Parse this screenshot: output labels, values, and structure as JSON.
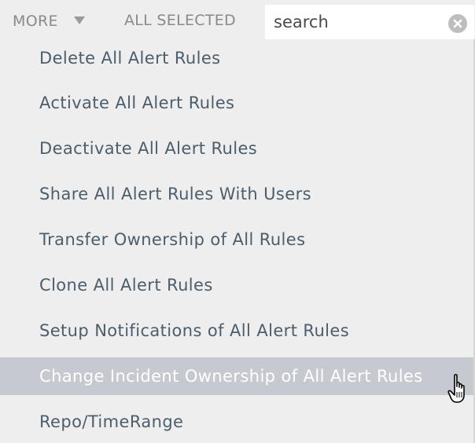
{
  "toolbar": {
    "more_label": "MORE",
    "all_selected_label": "ALL SELECTED",
    "search": {
      "value": "",
      "placeholder": "search"
    }
  },
  "menu": {
    "items": [
      {
        "label": "Delete All Alert Rules"
      },
      {
        "label": "Activate All Alert Rules"
      },
      {
        "label": "Deactivate All Alert Rules"
      },
      {
        "label": "Share All Alert Rules With Users"
      },
      {
        "label": "Transfer Ownership of All Rules"
      },
      {
        "label": "Clone All Alert Rules"
      },
      {
        "label": "Setup Notifications of All Alert Rules"
      },
      {
        "label": "Change Incident Ownership of All Alert Rules",
        "highlighted": true
      },
      {
        "label": "Repo/TimeRange"
      }
    ]
  },
  "icons": {
    "more_dropdown": "caret-down-icon",
    "clear_search": "close-circle-icon",
    "cursor": "hand-pointer-icon"
  },
  "colors": {
    "toolbar_text": "#8a8a8a",
    "menu_text": "#4c5d6c",
    "highlight_bg": "#c7c9d0",
    "highlight_text": "#ffffff",
    "menu_bg": "#eeeeee"
  }
}
